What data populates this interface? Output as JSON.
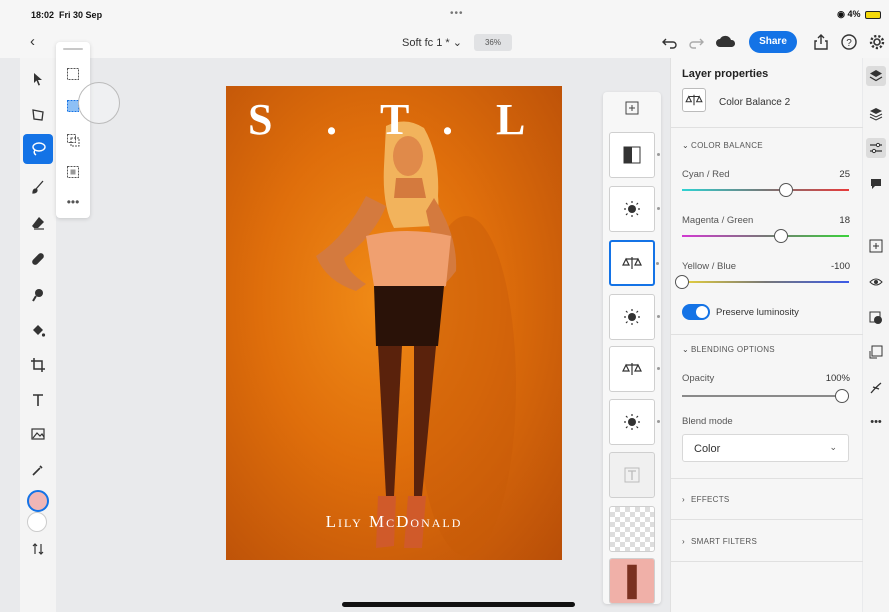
{
  "status": {
    "time": "18:02",
    "date": "Fri 30 Sep",
    "battery": "4%"
  },
  "header": {
    "doc_title": "Soft fc 1 *",
    "zoom": "36%",
    "share_label": "Share"
  },
  "canvas": {
    "title_letters": [
      "S",
      ".",
      "T",
      ".",
      "L"
    ],
    "caption": "Lily McDonald",
    "bg_color": "#e3720d"
  },
  "panel": {
    "title": "Layer properties",
    "layer_name": "Color Balance 2",
    "color_balance": {
      "header": "COLOR BALANCE",
      "sliders": [
        {
          "label": "Cyan / Red",
          "value": "25",
          "min": -100,
          "max": 100
        },
        {
          "label": "Magenta / Green",
          "value": "18",
          "min": -100,
          "max": 100
        },
        {
          "label": "Yellow / Blue",
          "value": "-100",
          "min": -100,
          "max": 100
        }
      ],
      "preserve_luminosity": "Preserve luminosity",
      "preserve_on": true
    },
    "blending": {
      "header": "BLENDING OPTIONS",
      "opacity_label": "Opacity",
      "opacity_value": "100%",
      "blend_label": "Blend mode",
      "blend_value": "Color"
    },
    "effects": "EFFECTS",
    "smart_filters": "SMART FILTERS"
  },
  "colors": {
    "accent": "#1473e6",
    "foreground_swatch": "#f0b6b6",
    "background_swatch": "#ffffff"
  }
}
